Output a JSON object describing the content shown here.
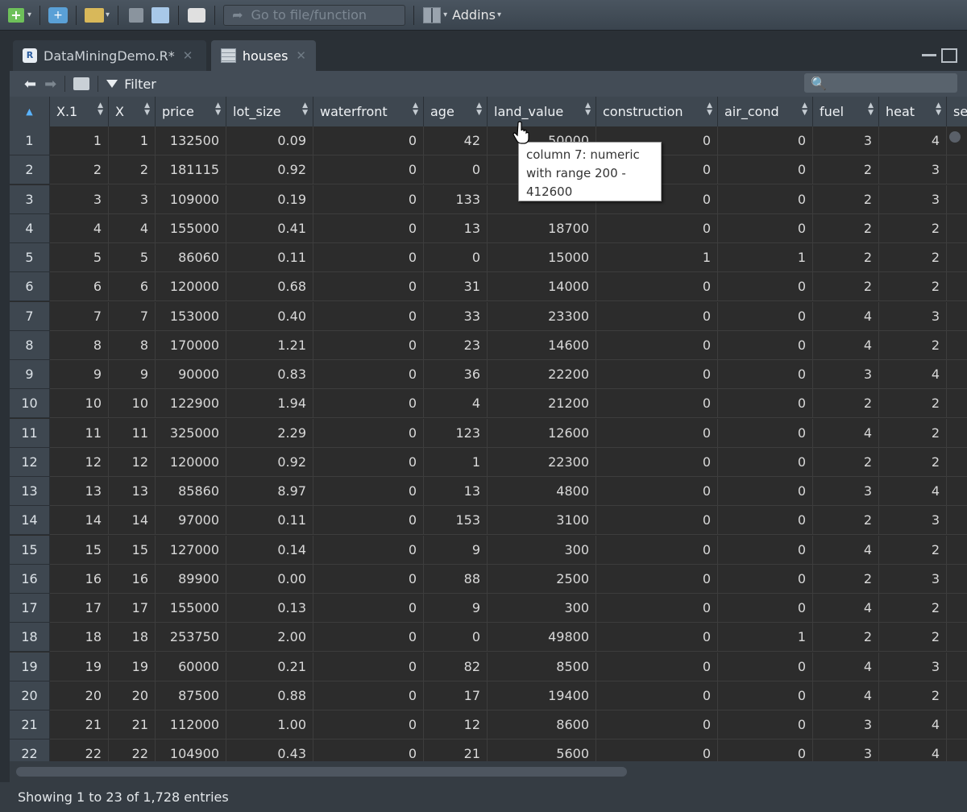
{
  "toolbar": {
    "goto_placeholder": "Go to file/function",
    "addins_label": "Addins"
  },
  "tabs": [
    {
      "label": "DataMiningDemo.R*",
      "active": false
    },
    {
      "label": "houses",
      "active": true
    }
  ],
  "viewer": {
    "filter_label": "Filter",
    "search_value": ""
  },
  "columns": [
    "X.1",
    "X",
    "price",
    "lot_size",
    "waterfront",
    "age",
    "land_value",
    "construction",
    "air_cond",
    "fuel",
    "heat",
    "se"
  ],
  "rows": [
    [
      "1",
      "1",
      "1",
      "132500",
      "0.09",
      "0",
      "42",
      "50000",
      "0",
      "0",
      "3",
      "4"
    ],
    [
      "2",
      "2",
      "2",
      "181115",
      "0.92",
      "0",
      "0",
      "",
      "0",
      "0",
      "2",
      "3"
    ],
    [
      "3",
      "3",
      "3",
      "109000",
      "0.19",
      "0",
      "133",
      "",
      "0",
      "0",
      "2",
      "3"
    ],
    [
      "4",
      "4",
      "4",
      "155000",
      "0.41",
      "0",
      "13",
      "18700",
      "0",
      "0",
      "2",
      "2"
    ],
    [
      "5",
      "5",
      "5",
      "86060",
      "0.11",
      "0",
      "0",
      "15000",
      "1",
      "1",
      "2",
      "2"
    ],
    [
      "6",
      "6",
      "6",
      "120000",
      "0.68",
      "0",
      "31",
      "14000",
      "0",
      "0",
      "2",
      "2"
    ],
    [
      "7",
      "7",
      "7",
      "153000",
      "0.40",
      "0",
      "33",
      "23300",
      "0",
      "0",
      "4",
      "3"
    ],
    [
      "8",
      "8",
      "8",
      "170000",
      "1.21",
      "0",
      "23",
      "14600",
      "0",
      "0",
      "4",
      "2"
    ],
    [
      "9",
      "9",
      "9",
      "90000",
      "0.83",
      "0",
      "36",
      "22200",
      "0",
      "0",
      "3",
      "4"
    ],
    [
      "10",
      "10",
      "10",
      "122900",
      "1.94",
      "0",
      "4",
      "21200",
      "0",
      "0",
      "2",
      "2"
    ],
    [
      "11",
      "11",
      "11",
      "325000",
      "2.29",
      "0",
      "123",
      "12600",
      "0",
      "0",
      "4",
      "2"
    ],
    [
      "12",
      "12",
      "12",
      "120000",
      "0.92",
      "0",
      "1",
      "22300",
      "0",
      "0",
      "2",
      "2"
    ],
    [
      "13",
      "13",
      "13",
      "85860",
      "8.97",
      "0",
      "13",
      "4800",
      "0",
      "0",
      "3",
      "4"
    ],
    [
      "14",
      "14",
      "14",
      "97000",
      "0.11",
      "0",
      "153",
      "3100",
      "0",
      "0",
      "2",
      "3"
    ],
    [
      "15",
      "15",
      "15",
      "127000",
      "0.14",
      "0",
      "9",
      "300",
      "0",
      "0",
      "4",
      "2"
    ],
    [
      "16",
      "16",
      "16",
      "89900",
      "0.00",
      "0",
      "88",
      "2500",
      "0",
      "0",
      "2",
      "3"
    ],
    [
      "17",
      "17",
      "17",
      "155000",
      "0.13",
      "0",
      "9",
      "300",
      "0",
      "0",
      "4",
      "2"
    ],
    [
      "18",
      "18",
      "18",
      "253750",
      "2.00",
      "0",
      "0",
      "49800",
      "0",
      "1",
      "2",
      "2"
    ],
    [
      "19",
      "19",
      "19",
      "60000",
      "0.21",
      "0",
      "82",
      "8500",
      "0",
      "0",
      "4",
      "3"
    ],
    [
      "20",
      "20",
      "20",
      "87500",
      "0.88",
      "0",
      "17",
      "19400",
      "0",
      "0",
      "4",
      "2"
    ],
    [
      "21",
      "21",
      "21",
      "112000",
      "1.00",
      "0",
      "12",
      "8600",
      "0",
      "0",
      "3",
      "4"
    ],
    [
      "22",
      "22",
      "22",
      "104900",
      "0.43",
      "0",
      "21",
      "5600",
      "0",
      "0",
      "3",
      "4"
    ]
  ],
  "tooltip": {
    "line1": "column 7: numeric",
    "line2": "with range 200 -",
    "line3": "412600"
  },
  "status": "Showing 1 to 23 of 1,728 entries"
}
